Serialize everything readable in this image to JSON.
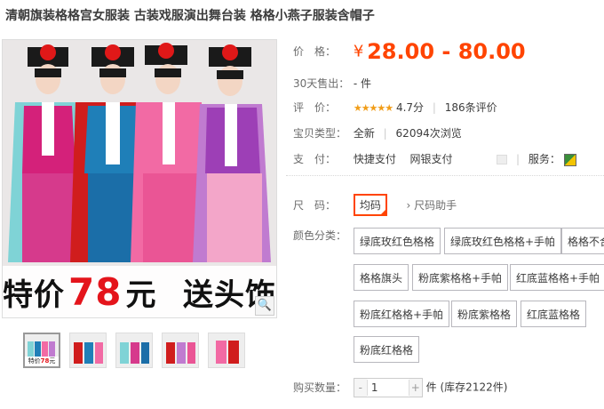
{
  "title": "清朝旗装格格宫女服装 古装戏服演出舞台装 格格小燕子服装含帽子",
  "promo": {
    "prefix": "特价",
    "price": "78",
    "suffix": "元",
    "extra": "送头饰"
  },
  "price": {
    "label": "价　格：",
    "symbol": "¥",
    "value": "28.00 - 80.00"
  },
  "sales": {
    "label": "30天售出：",
    "value": "- 件"
  },
  "rating": {
    "label": "评　价：",
    "stars": "★★★★★",
    "score": "4.7分",
    "count": "186条评价"
  },
  "item_type": {
    "label": "宝贝类型：",
    "value": "全新",
    "views": "62094次浏览"
  },
  "payment": {
    "label": "支　付：",
    "methods": [
      "快捷支付",
      "网银支付"
    ],
    "service_label": "服务："
  },
  "size": {
    "label": "尺　码：",
    "selected": "均码",
    "helper": "尺码助手"
  },
  "colors": {
    "label": "颜色分类：",
    "options": [
      "绿底玫红色格格",
      "绿底玫红色格格+手帕",
      "格格不合",
      "格格旗头",
      "粉底紫格格+手帕",
      "红底蓝格格+手帕",
      "粉底红格格+手帕",
      "粉底紫格格",
      "红底蓝格格",
      "粉底红格格"
    ]
  },
  "quantity": {
    "label": "购买数量：",
    "value": "1",
    "minus": "-",
    "plus": "+",
    "unit": "件",
    "stock": "(库存2122件)"
  },
  "icons": {
    "zoom": "magnifier-icon",
    "service": "service-icon",
    "dropdown": "chevron-down-icon"
  },
  "accent": "#ff4400"
}
